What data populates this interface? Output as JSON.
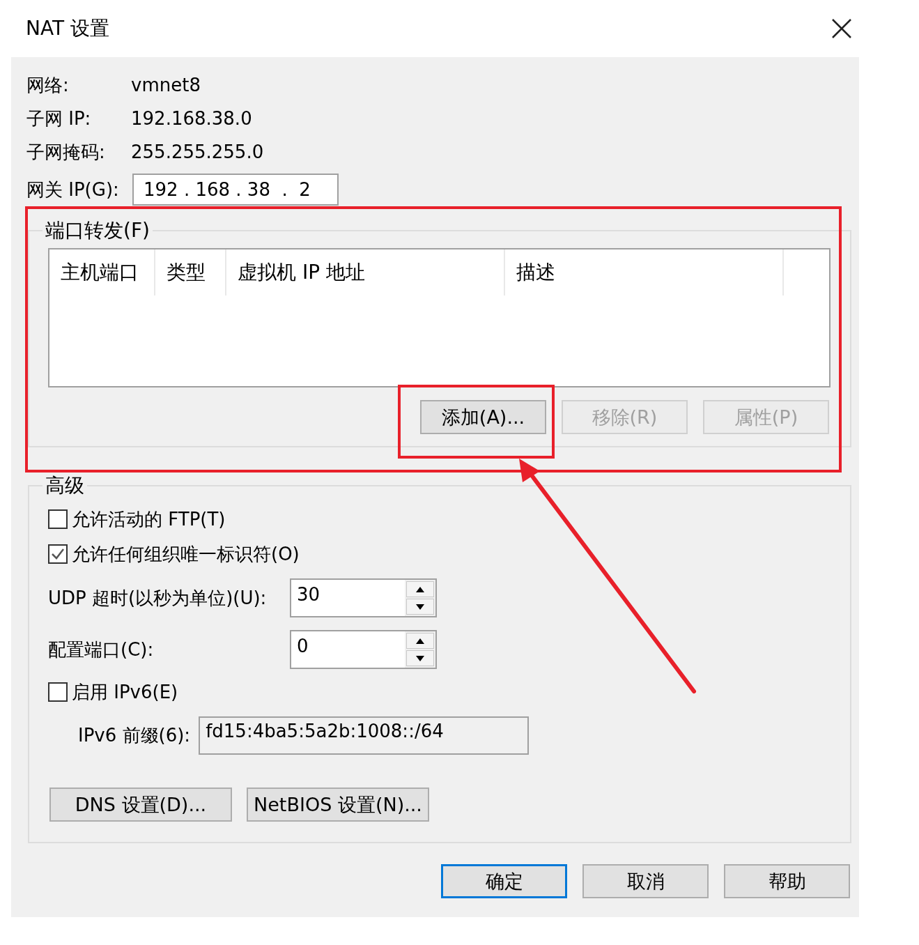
{
  "window": {
    "title": "NAT 设置"
  },
  "info": [
    {
      "label": "网络:",
      "value": "vmnet8"
    },
    {
      "label": "子网 IP:",
      "value": "192.168.38.0"
    },
    {
      "label": "子网掩码:",
      "value": "255.255.255.0"
    }
  ],
  "gateway": {
    "label": "网关 IP(G):",
    "value": "192 . 168 . 38  .  2"
  },
  "port_forwarding": {
    "title": "端口转发(F)",
    "columns": [
      "主机端口",
      "类型",
      "虚拟机 IP 地址",
      "描述"
    ],
    "buttons": [
      {
        "label": "添加(A)...",
        "disabled": false
      },
      {
        "label": "移除(R)",
        "disabled": true
      },
      {
        "label": "属性(P)",
        "disabled": true
      }
    ]
  },
  "advanced": {
    "title": "高级",
    "items": [
      {
        "kind": "checkbox",
        "label": "允许活动的 FTP(T)",
        "checked": false
      },
      {
        "kind": "checkbox",
        "label": "允许任何组织唯一标识符(O)",
        "checked": true
      },
      {
        "kind": "spinner",
        "label": "UDP 超时(以秒为单位)(U):",
        "value": "30"
      },
      {
        "kind": "spinner",
        "label": "配置端口(C):",
        "value": "0"
      },
      {
        "kind": "checkbox",
        "label": "启用 IPv6(E)",
        "checked": false
      },
      {
        "kind": "field",
        "label": "IPv6 前缀(6):",
        "value": "fd15:4ba5:5a2b:1008::/64",
        "disabled": true
      }
    ],
    "buttons": [
      "DNS 设置(D)...",
      "NetBIOS 设置(N)..."
    ]
  },
  "buttons": [
    {
      "label": "确定",
      "default": true
    },
    {
      "label": "取消",
      "default": false
    },
    {
      "label": "帮助",
      "default": false
    }
  ]
}
